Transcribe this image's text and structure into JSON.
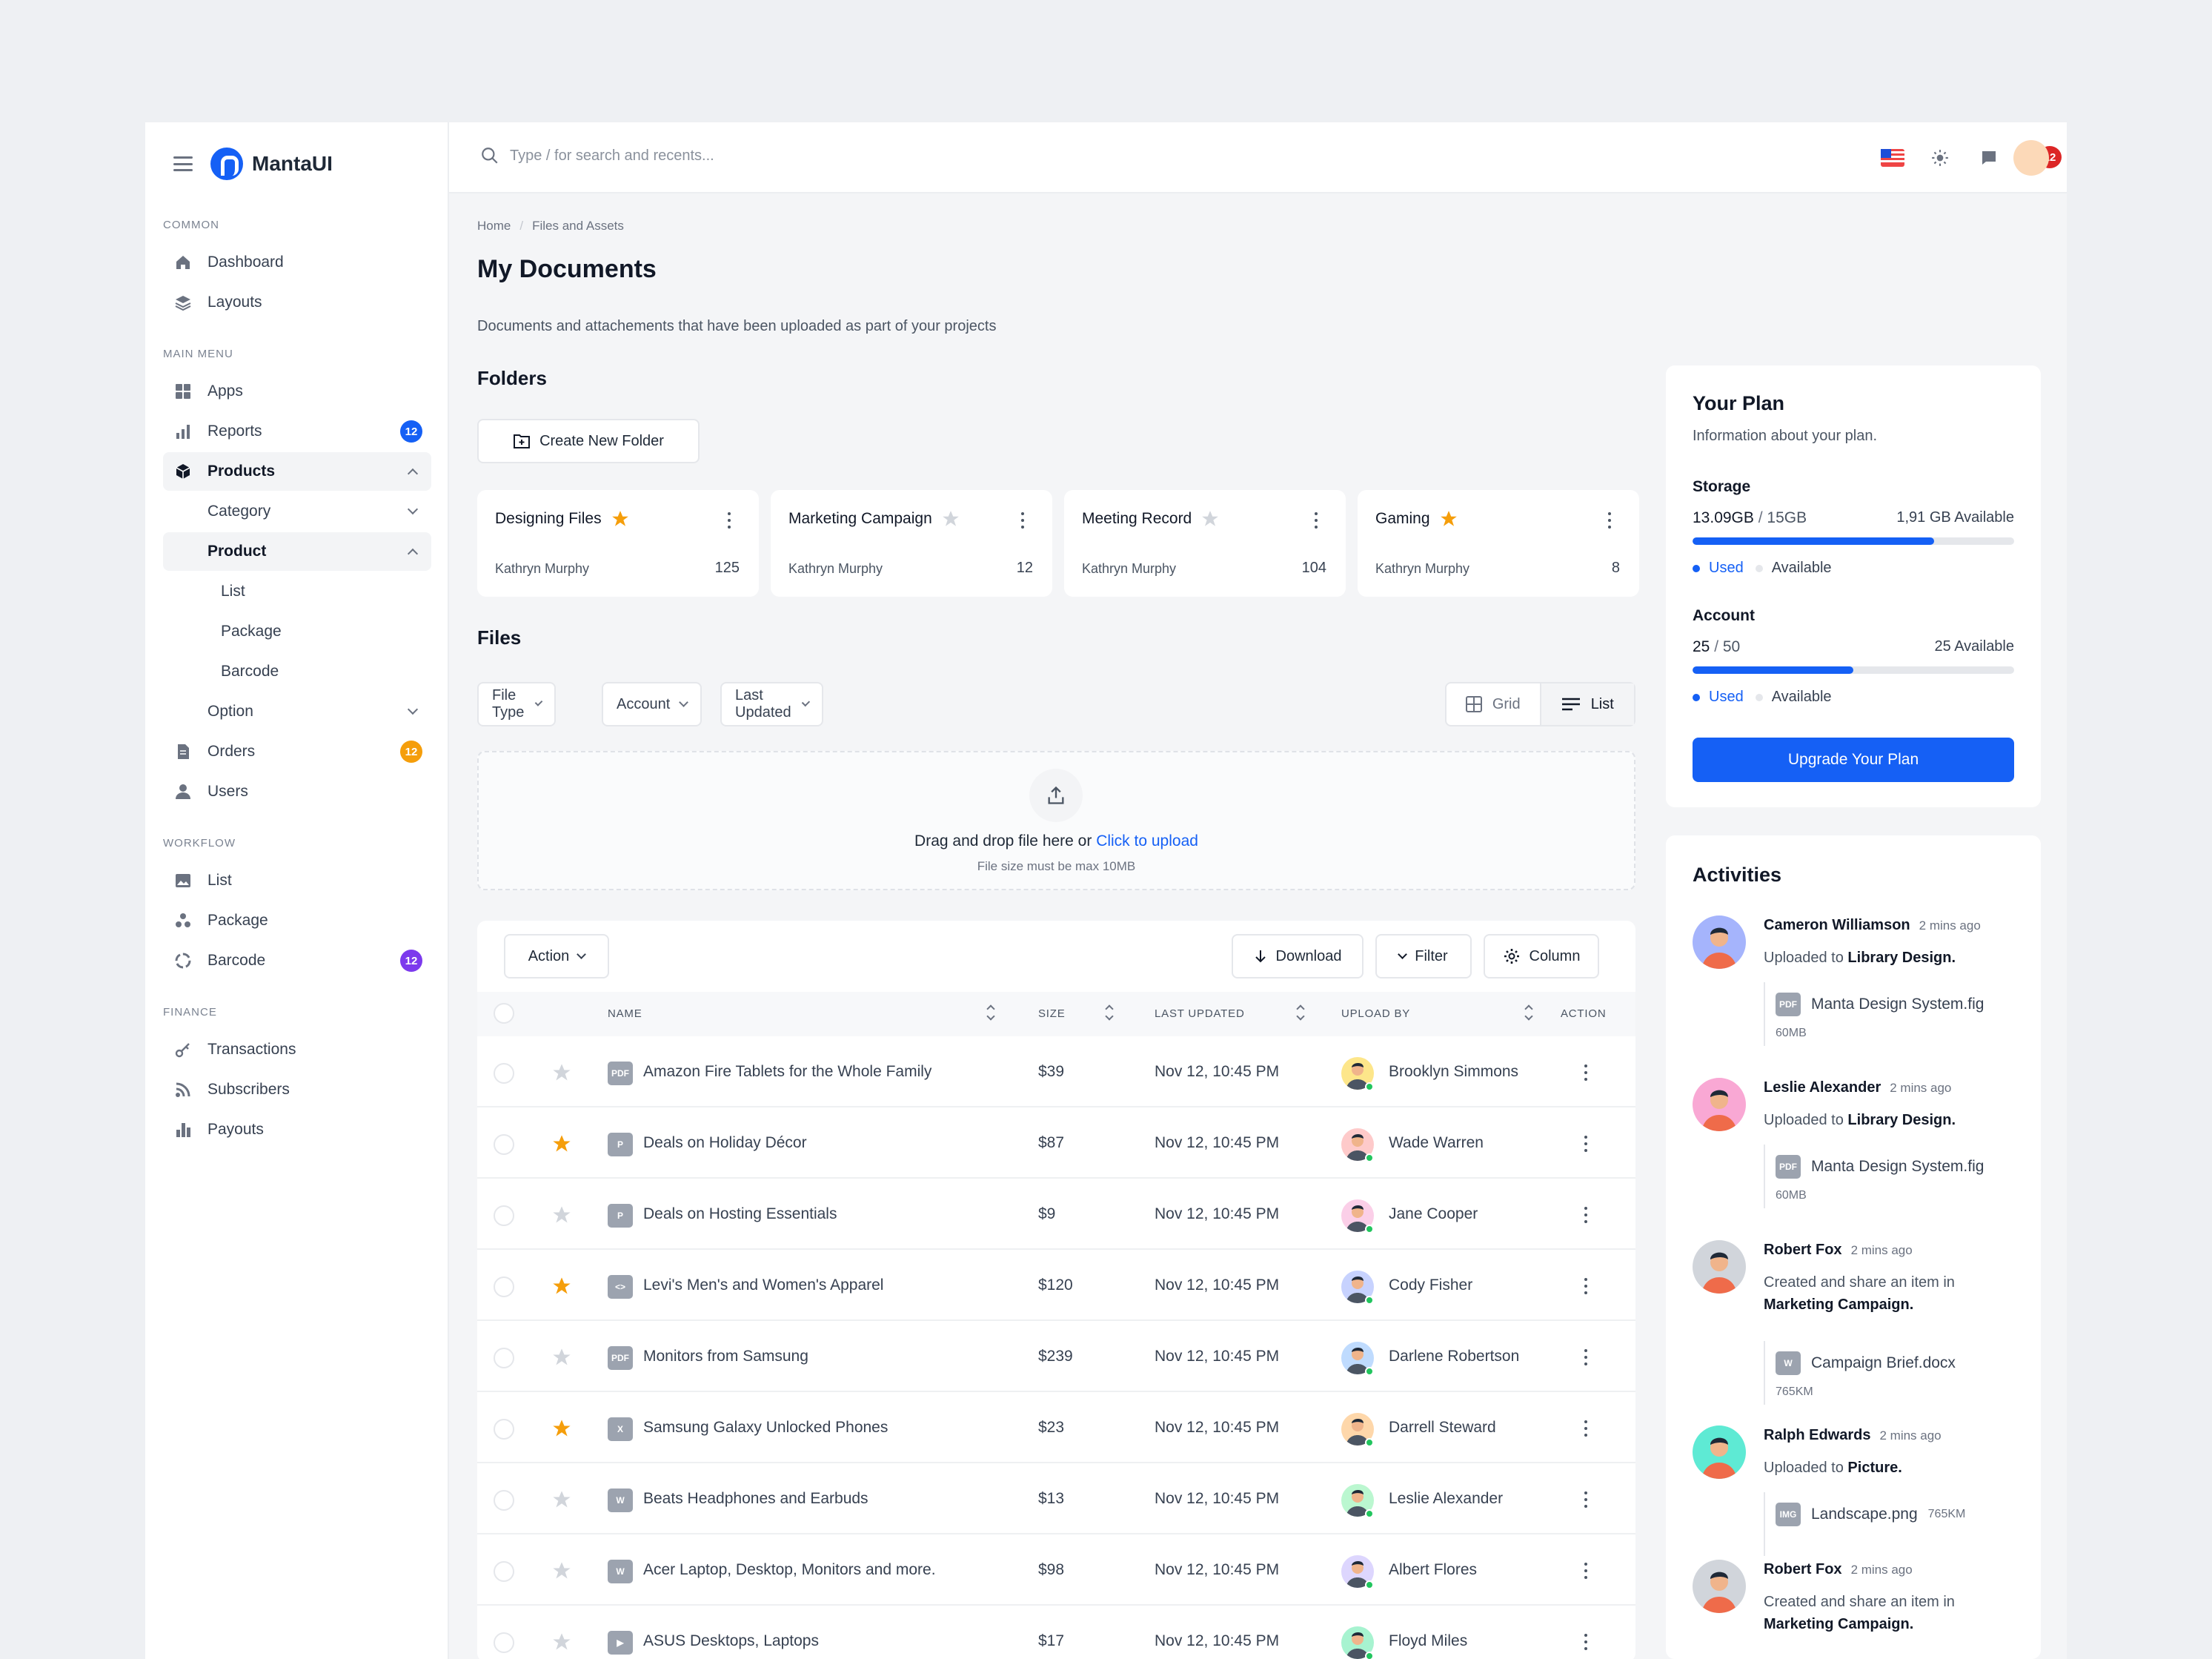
{
  "brand": {
    "name": "MantaUI",
    "accent": "#1560f5"
  },
  "sidebar": {
    "sections": [
      "COMMON",
      "MAIN MENU",
      "WORKFLOW",
      "FINANCE"
    ],
    "common": [
      "Dashboard",
      "Layouts"
    ],
    "main": {
      "apps": "Apps",
      "reports": "Reports",
      "reports_badge": "12",
      "products": "Products",
      "category": "Category",
      "product": "Product",
      "list": "List",
      "package": "Package",
      "barcode": "Barcode",
      "option": "Option",
      "orders": "Orders",
      "orders_badge": "12",
      "users": "Users"
    },
    "workflow": {
      "list": "List",
      "package": "Package",
      "barcode": "Barcode",
      "barcode_badge": "12"
    },
    "finance": [
      "Transactions",
      "Subscribers",
      "Payouts"
    ]
  },
  "topbar": {
    "search_placeholder": "Type / for search and recents...",
    "notif_count": "12"
  },
  "breadcrumb": {
    "home": "Home",
    "current": "Files and Assets"
  },
  "page": {
    "title": "My Documents",
    "description": "Documents and attachements that have been uploaded as part of your projects",
    "folders_heading": "Folders",
    "create_folder": "Create New Folder",
    "files_heading": "Files"
  },
  "folders": [
    {
      "name": "Designing Files",
      "starred": true,
      "owner": "Kathryn Murphy",
      "count": "125"
    },
    {
      "name": "Marketing Campaign",
      "starred": false,
      "owner": "Kathryn Murphy",
      "count": "12"
    },
    {
      "name": "Meeting Record",
      "starred": false,
      "owner": "Kathryn Murphy",
      "count": "104"
    },
    {
      "name": "Gaming",
      "starred": true,
      "owner": "Kathryn Murphy",
      "count": "8"
    }
  ],
  "filters": {
    "file_type": "File Type",
    "account": "Account",
    "last_updated": "Last Updated",
    "grid": "Grid",
    "list": "List"
  },
  "upload": {
    "text": "Drag and drop file here or ",
    "link": "Click to upload",
    "hint": "File size must be max 10MB"
  },
  "table": {
    "action": "Action",
    "download": "Download",
    "filter": "Filter",
    "column": "Column",
    "headers": {
      "name": "NAME",
      "size": "SIZE",
      "updated": "LAST UPDATED",
      "upload_by": "UPLOAD BY",
      "action": "ACTION"
    },
    "rows": [
      {
        "icon": "PDF",
        "name": "Amazon Fire Tablets for the Whole Family",
        "size": "$39",
        "date": "Nov 12, 10:45 PM",
        "user": "Brooklyn Simmons",
        "starred": false
      },
      {
        "icon": "P",
        "name": "Deals on Holiday Décor",
        "size": "$87",
        "date": "Nov 12, 10:45 PM",
        "user": "Wade Warren",
        "starred": true
      },
      {
        "icon": "P",
        "name": "Deals on Hosting Essentials",
        "size": "$9",
        "date": "Nov 12, 10:45 PM",
        "user": "Jane Cooper",
        "starred": false
      },
      {
        "icon": "<>",
        "name": "Levi's Men's and Women's Apparel",
        "size": "$120",
        "date": "Nov 12, 10:45 PM",
        "user": "Cody Fisher",
        "starred": true
      },
      {
        "icon": "PDF",
        "name": "Monitors from Samsung",
        "size": "$239",
        "date": "Nov 12, 10:45 PM",
        "user": "Darlene Robertson",
        "starred": false
      },
      {
        "icon": "X",
        "name": "Samsung Galaxy Unlocked Phones",
        "size": "$23",
        "date": "Nov 12, 10:45 PM",
        "user": "Darrell Steward",
        "starred": true
      },
      {
        "icon": "W",
        "name": "Beats Headphones and Earbuds",
        "size": "$13",
        "date": "Nov 12, 10:45 PM",
        "user": "Leslie Alexander",
        "starred": false
      },
      {
        "icon": "W",
        "name": "Acer Laptop, Desktop, Monitors and more.",
        "size": "$98",
        "date": "Nov 12, 10:45 PM",
        "user": "Albert Flores",
        "starred": false
      },
      {
        "icon": "▶",
        "name": "ASUS Desktops, Laptops",
        "size": "$17",
        "date": "Nov 12, 10:45 PM",
        "user": "Floyd Miles",
        "starred": false
      }
    ]
  },
  "plan": {
    "title": "Your Plan",
    "subtitle": "Information about your plan.",
    "storage_label": "Storage",
    "storage_used": "13.09GB",
    "storage_total": "15GB",
    "storage_available": "1,91 GB Available",
    "storage_fraction": 0.75,
    "account_label": "Account",
    "account_used": "25",
    "account_total": "50",
    "account_available": "25 Available",
    "account_fraction": 0.5,
    "used": "Used",
    "available": "Available",
    "upgrade": "Upgrade Your Plan"
  },
  "activities": {
    "title": "Activities",
    "items": [
      {
        "name": "Cameron Williamson",
        "time": "2 mins ago",
        "text": "Uploaded to ",
        "target": "Library Design.",
        "file": "Manta Design System.fig",
        "ficon": "PDF",
        "fsize": "60MB"
      },
      {
        "name": "Leslie Alexander",
        "time": "2 mins ago",
        "text": "Uploaded to ",
        "target": "Library Design.",
        "file": "Manta Design System.fig",
        "ficon": "PDF",
        "fsize": "60MB"
      },
      {
        "name": "Robert Fox",
        "time": "2 mins ago",
        "text": "Created and share an item in ",
        "target": "Marketing Campaign.",
        "file": "Campaign Brief.docx",
        "ficon": "W",
        "fsize": "765KM"
      },
      {
        "name": "Ralph Edwards",
        "time": "2 mins ago",
        "text": "Uploaded to ",
        "target": "Picture.",
        "file": "Landscape.png",
        "ficon": "IMG",
        "fsize": "765KM"
      },
      {
        "name": "Robert Fox",
        "time": "2 mins ago",
        "text": "Created and share an item in ",
        "target": "Marketing Campaign."
      }
    ]
  }
}
